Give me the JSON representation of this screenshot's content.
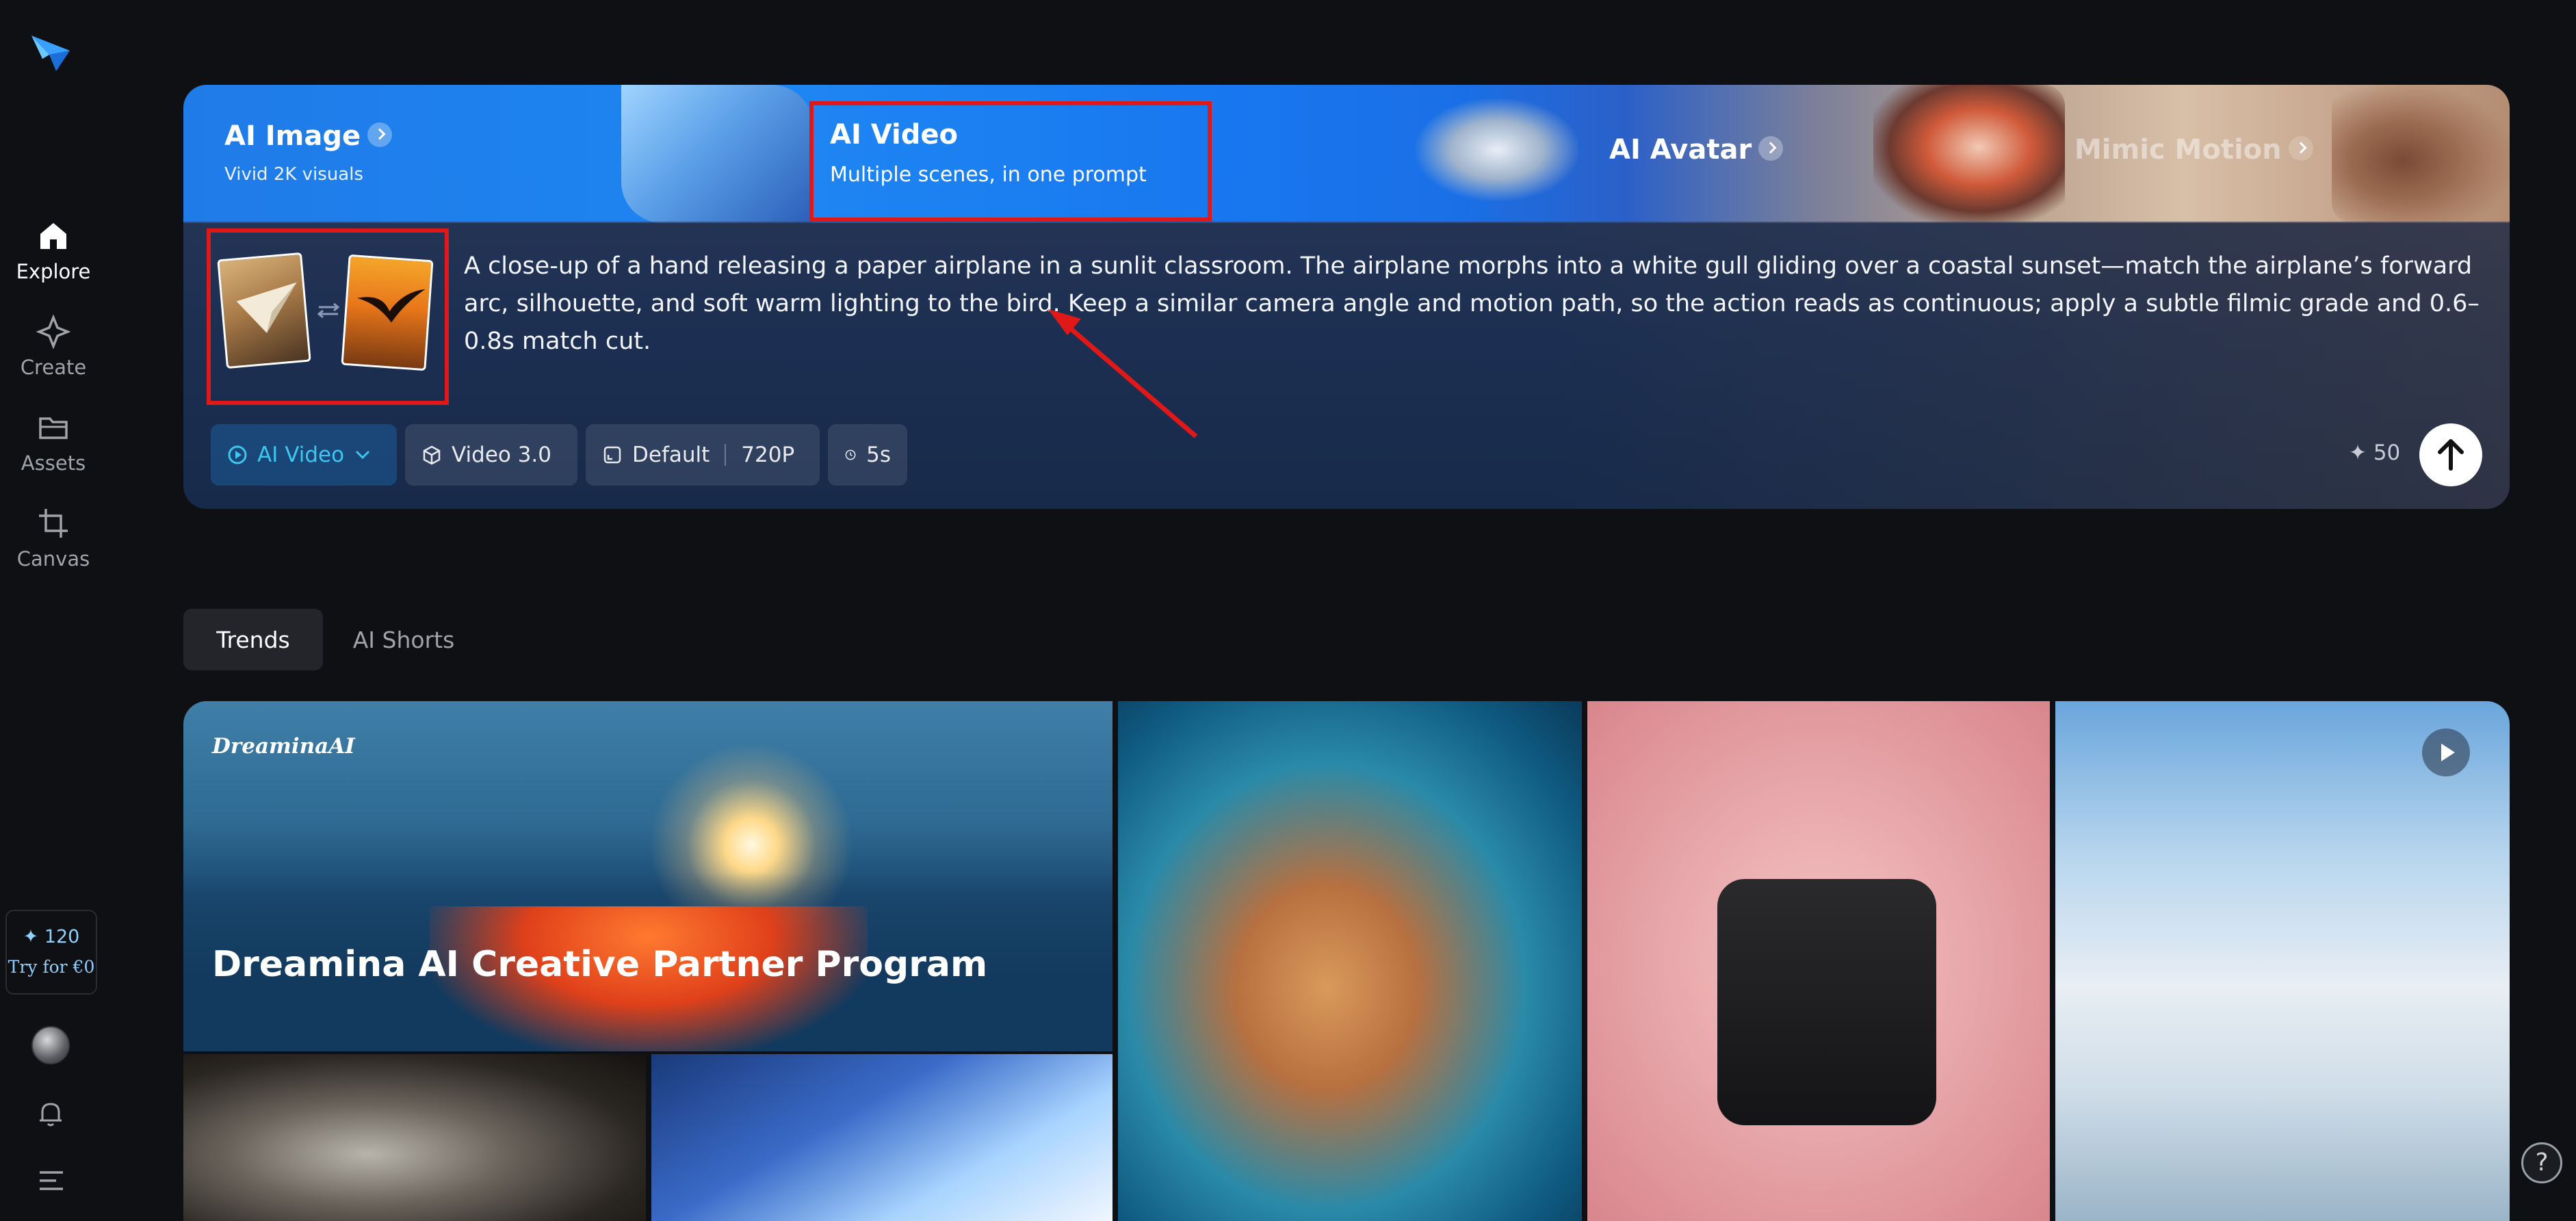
{
  "sidebar": {
    "items": [
      {
        "label": "Explore",
        "icon": "home-icon"
      },
      {
        "label": "Create",
        "icon": "sparkle-icon"
      },
      {
        "label": "Assets",
        "icon": "folder-icon"
      },
      {
        "label": "Canvas",
        "icon": "crop-icon"
      }
    ],
    "credits": {
      "amount": "✦ 120",
      "cta": "Try for €0"
    }
  },
  "hero": {
    "tabs": [
      {
        "title": "AI Image",
        "subtitle": "Vivid 2K visuals"
      },
      {
        "title": "AI Video",
        "subtitle": "Multiple scenes, in one prompt"
      },
      {
        "title": "AI Avatar",
        "subtitle": ""
      },
      {
        "title": "Mimic Motion",
        "subtitle": ""
      }
    ],
    "prompt": "A close-up of a hand releasing a paper airplane in a sunlit classroom. The airplane morphs into a white gull gliding over a coastal sunset—match the airplane’s forward arc, silhouette, and soft warm lighting to the bird. Keep a similar camera angle and motion path, so the action reads as continuous; apply a subtle filmic grade and 0.6–0.8s match cut.",
    "toolbar": {
      "mode": "AI Video",
      "model": "Video 3.0",
      "ratio": "Default",
      "resolution": "720P",
      "duration": "5s",
      "cost": "✦ 50"
    }
  },
  "feed": {
    "tabs": [
      "Trends",
      "AI Shorts"
    ],
    "promo": {
      "brand": "DreaminaAI",
      "title": "Dreamina AI Creative Partner Program"
    }
  },
  "help_label": "?",
  "colors": {
    "accent": "#3dc7f0",
    "highlight": "#e01818",
    "background": "#0f1013"
  }
}
